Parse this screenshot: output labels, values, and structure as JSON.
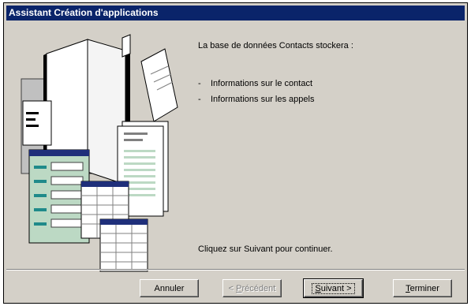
{
  "window": {
    "title": "Assistant Création d'applications"
  },
  "content": {
    "intro": "La base de données Contacts stockera :",
    "bullets": [
      {
        "marker": "-",
        "text": "Informations sur le contact"
      },
      {
        "marker": "-",
        "text": "Informations sur les appels"
      }
    ],
    "footer": "Cliquez sur Suivant pour continuer."
  },
  "buttons": {
    "cancel": "Annuler",
    "previous_prefix": "< ",
    "previous_hotkey": "P",
    "previous_rest": "récédent",
    "next_hotkey": "S",
    "next_rest": "uivant >",
    "finish_hotkey": "T",
    "finish_rest": "erminer"
  },
  "colors": {
    "titlebar": "#0a246a",
    "face": "#d4d0c8",
    "binder_header": "#1f2f7a",
    "form_green": "#bcd9c4",
    "form_teal": "#1f8a8a"
  }
}
